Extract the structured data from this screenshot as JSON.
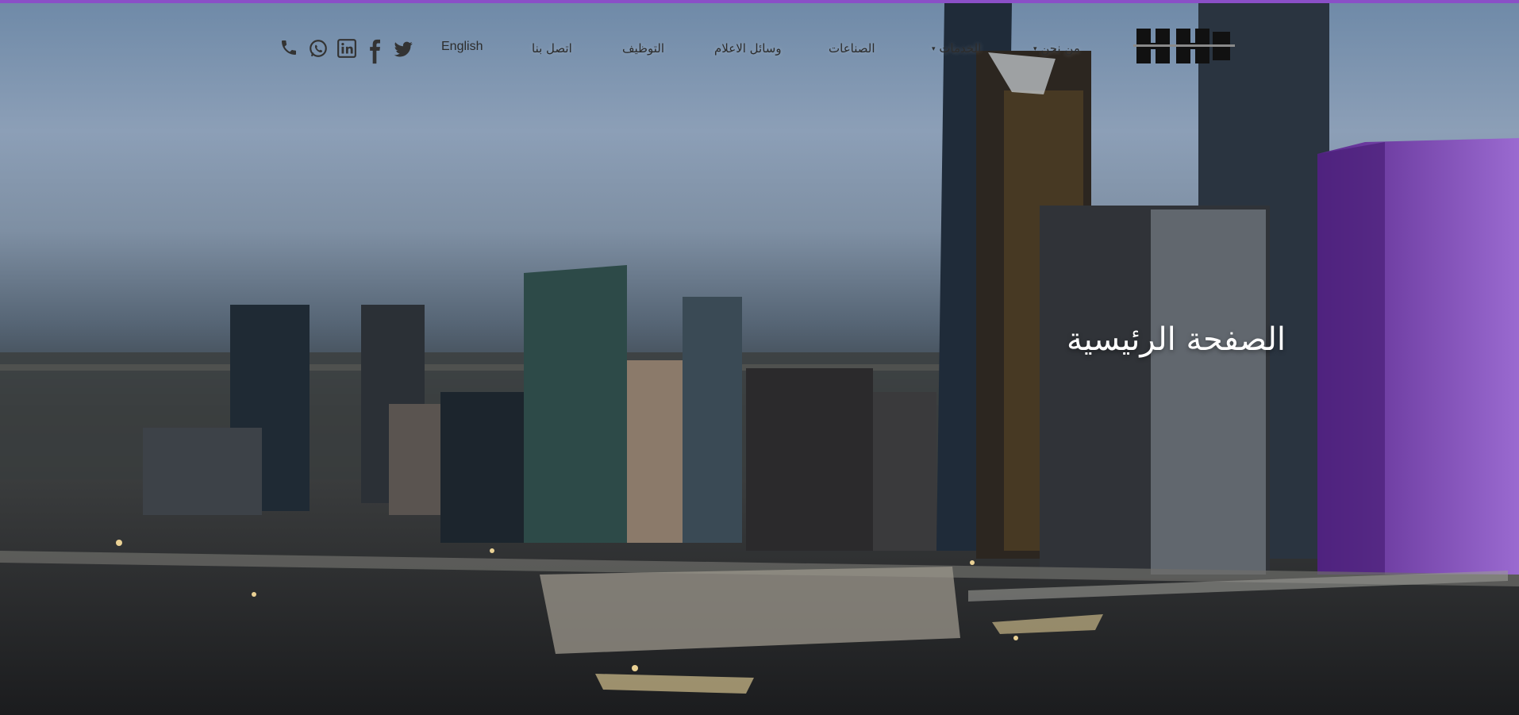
{
  "nav": {
    "logo_label": "logo",
    "items": [
      {
        "label": "من نحن",
        "has_dropdown": true
      },
      {
        "label": "الخدمات",
        "has_dropdown": true
      },
      {
        "label": "الصناعات",
        "has_dropdown": false
      },
      {
        "label": "وسائل الاعلام",
        "has_dropdown": false
      },
      {
        "label": "التوظيف",
        "has_dropdown": false
      },
      {
        "label": "اتصل بنا",
        "has_dropdown": false
      }
    ],
    "language": "English",
    "social_icons": [
      "twitter-icon",
      "facebook-icon",
      "linkedin-icon",
      "whatsapp-icon",
      "phone-icon"
    ]
  },
  "hero": {
    "title": "الصفحة الرئيسية"
  },
  "colors": {
    "accent_bar": "#8a4fc7",
    "nav_text": "#2c2c2c",
    "hero_title": "#ffffff"
  }
}
